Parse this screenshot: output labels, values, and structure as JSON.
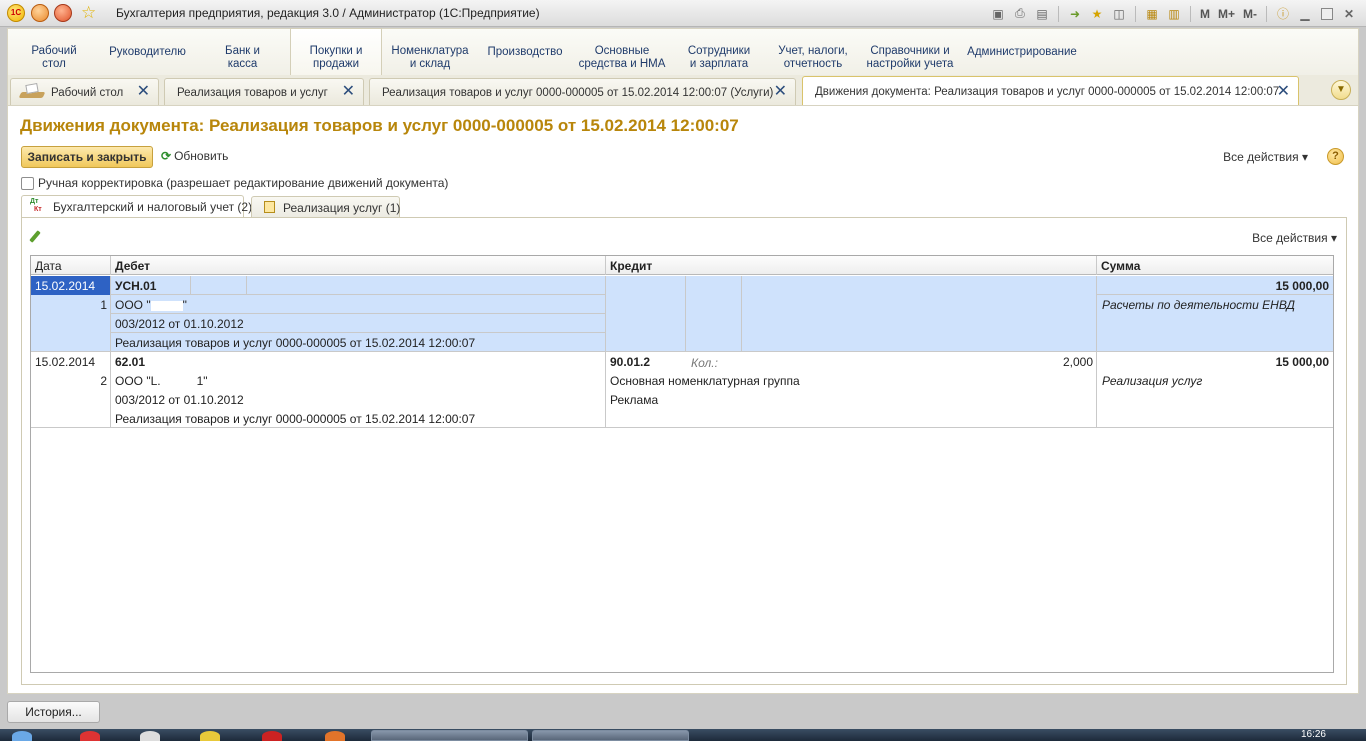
{
  "window": {
    "title": "Бухгалтерия предприятия, редакция 3.0 / Администратор  (1С:Предприятие)",
    "logo_text": "1С",
    "right_buttons": [
      "M",
      "M+",
      "M-"
    ]
  },
  "sections": [
    {
      "label": "Рабочий\nстол"
    },
    {
      "label": "Руководителю"
    },
    {
      "label": "Банк и\nкасса"
    },
    {
      "label": "Покупки и\nпродажи"
    },
    {
      "label": "Номенклатура\nи склад"
    },
    {
      "label": "Производство"
    },
    {
      "label": "Основные\nсредства и НМА"
    },
    {
      "label": "Сотрудники\nи зарплата"
    },
    {
      "label": "Учет, налоги,\nотчетность"
    },
    {
      "label": "Справочники и\nнастройки учета"
    },
    {
      "label": "Администрирование"
    }
  ],
  "open_tabs": [
    {
      "label": "Рабочий стол",
      "close": "✕"
    },
    {
      "label": "Реализация товаров и услуг",
      "close": "✕"
    },
    {
      "label": "Реализация товаров и услуг 0000-000005 от 15.02.2014 12:00:07 (Услуги)",
      "close": "✕"
    },
    {
      "label": "Движения документа: Реализация товаров и услуг 0000-000005 от 15.02.2014 12:00:07",
      "close": "✕"
    }
  ],
  "form": {
    "title": "Движения документа: Реализация товаров и услуг 0000-000005 от 15.02.2014 12:00:07",
    "save_close": "Записать и закрыть",
    "refresh": "Обновить",
    "all_actions": "Все действия ▾",
    "help": "?",
    "manual_checkbox_label": "Ручная корректировка (разрешает редактирование движений документа)",
    "manual_checked": false
  },
  "inner_tabs": [
    {
      "label": "Бухгалтерский и налоговый учет (2)",
      "icon_top": "Дт",
      "icon_bottom": "Кт"
    },
    {
      "label": "Реализация услуг (1)"
    }
  ],
  "grid": {
    "all_actions": "Все действия ▾",
    "columns": {
      "date": "Дата",
      "debit": "Дебет",
      "credit": "Кредит",
      "amount": "Сумма"
    },
    "rows": [
      {
        "date": "15.02.2014",
        "num": "1",
        "debit_account": "УСН.01",
        "debit_sub1": "ООО \"",
        "debit_sub1_end": "\"",
        "debit_sub2": "003/2012 от 01.10.2012",
        "debit_sub3": "Реализация товаров и услуг 0000-000005 от 15.02.2014 12:00:07",
        "credit_account": "",
        "amount": "15 000,00",
        "amount_note": "Расчеты по деятельности ЕНВД"
      },
      {
        "date": "15.02.2014",
        "num": "2",
        "debit_account": "62.01",
        "debit_sub1": "ООО \"L.",
        "debit_sub1_end": "1\"",
        "debit_sub2": "003/2012 от 01.10.2012",
        "debit_sub3": "Реализация товаров и услуг 0000-000005 от 15.02.2014 12:00:07",
        "credit_account": "90.01.2",
        "credit_qty_label": "Кол.:",
        "credit_qty": "2,000",
        "credit_sub1": "Основная номенклатурная группа",
        "credit_sub2": "Реклама",
        "amount": "15 000,00",
        "amount_note": "Реализация услуг"
      }
    ]
  },
  "bottom": {
    "history": "История...",
    "clock": "16:26"
  }
}
